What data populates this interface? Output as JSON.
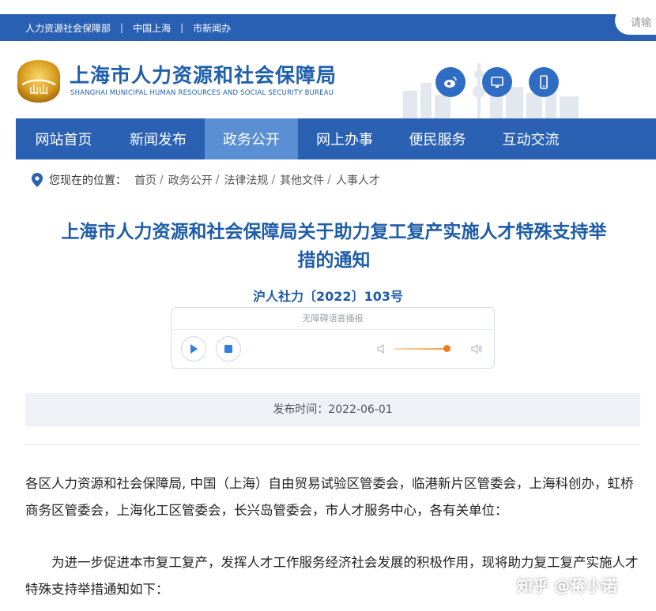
{
  "topbar": {
    "links": [
      "人力资源社会保障部",
      "中国上海",
      "市新闻办"
    ],
    "separator": "|"
  },
  "header": {
    "title": "上海市人力资源和社会保障局",
    "subtitle": "SHANGHAI MUNICIPAL HUMAN RESOURCES AND SOCIAL SECURITY BUREAU",
    "logo_text": "山山",
    "icons": [
      "weibo-icon",
      "monitor-icon",
      "mobile-icon"
    ]
  },
  "nav": {
    "items": [
      "网站首页",
      "新闻发布",
      "政务公开",
      "网上办事",
      "便民服务",
      "互动交流"
    ],
    "active": "政务公开",
    "search_placeholder": "请输"
  },
  "breadcrumb": {
    "lead": "您现在的位置：",
    "items": [
      "首页",
      "政务公开",
      "法律法规",
      "其他文件",
      "人事人才"
    ],
    "separator": "/"
  },
  "article": {
    "title_line1": "上海市人力资源和社会保障局关于助力复工复产实施人才特殊支持举",
    "title_line2": "措的通知",
    "doc_number": "沪人社力〔2022〕103号",
    "publish_label": "发布时间：2022-06-01",
    "para1": "各区人力资源和社会保障局, 中国（上海）自由贸易试验区管委会，临港新片区管委会，上海科创办，虹桥商务区管委会，上海化工区管委会，长兴岛管委会，市人才服务中心，各有关单位：",
    "para2": "为进一步促进本市复工复产，发挥人才工作服务经济社会发展的积极作用，现将助力复工复产实施人才特殊支持举措通知如下："
  },
  "player": {
    "label": "无障碍语音播报",
    "volume_level": 0.85
  },
  "watermark": "知乎 @蒋小诺",
  "colors": {
    "primary": "#2a60b4",
    "nav_active": "#5a8fd3",
    "title_blue": "#1f5ca8",
    "accent_orange": "#f07a22"
  }
}
